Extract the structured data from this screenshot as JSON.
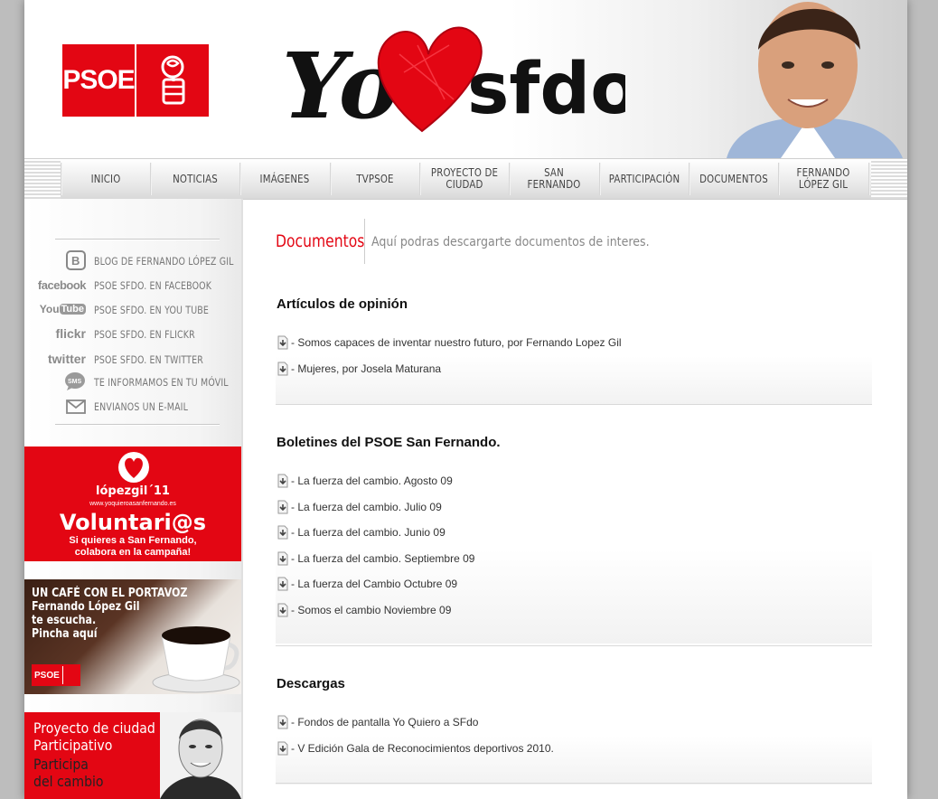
{
  "header": {
    "psoe_logo_text": "PSOE",
    "brand_text": "Yo ♥ sfdo",
    "brand_left": "Yo",
    "brand_right": "sfdo"
  },
  "nav": {
    "items": [
      {
        "label": "INICIO"
      },
      {
        "label": "NOTICIAS"
      },
      {
        "label": "IMÁGENES"
      },
      {
        "label": "TVPSOE"
      },
      {
        "label": "PROYECTO DE CIUDAD"
      },
      {
        "label": "SAN FERNANDO"
      },
      {
        "label": "PARTICIPACIÓN"
      },
      {
        "label": "DOCUMENTOS"
      },
      {
        "label": "FERNANDO LÓPEZ GIL"
      }
    ]
  },
  "sidebar": {
    "social": [
      {
        "icon": "blogger-icon",
        "icon_text": "B",
        "label": "BLOG DE FERNANDO LÓPEZ GIL"
      },
      {
        "icon": "facebook-icon",
        "icon_text": "facebook",
        "label": "PSOE SFDO.  EN FACEBOOK"
      },
      {
        "icon": "youtube-icon",
        "icon_text": "YouTube",
        "label": "PSOE SFDO.  EN YOU TUBE"
      },
      {
        "icon": "flickr-icon",
        "icon_text": "flickr",
        "label": "PSOE SFDO.  EN FLICKR"
      },
      {
        "icon": "twitter-icon",
        "icon_text": "twitter",
        "label": "PSOE SFDO.  EN TWITTER"
      },
      {
        "icon": "sms-icon",
        "icon_text": "SMS",
        "label": "TE INFORMAMOS EN TU MÓVIL"
      },
      {
        "icon": "email-icon",
        "icon_text": "",
        "label": "ENVIANOS UN E-MAIL"
      }
    ],
    "banner_voluntarios": {
      "tag": "lópezgil´11",
      "url": "www.yoquieroasanfernando.es",
      "title": "Voluntari@s",
      "line1": "Si quieres a San Fernando,",
      "line2": "colabora en la campaña!"
    },
    "banner_cafe": {
      "line1": "UN CAFÉ CON EL PORTAVOZ",
      "line2": "Fernando López Gil",
      "line3": "te escucha.",
      "line4": "Pincha aquí",
      "logo": "PSOE"
    },
    "banner_proyecto": {
      "line1": "Proyecto de ciudad",
      "line2": "Participativo",
      "line3": "Participa",
      "line4": "del cambio"
    }
  },
  "main": {
    "title": "Documentos",
    "subtitle": "Aquí podras descargarte documentos de interes.",
    "sections": [
      {
        "title": "Artículos de opinión",
        "links": [
          "- Somos capaces de inventar nuestro futuro, por Fernando Lopez Gil",
          "- Mujeres, por Josela Maturana"
        ]
      },
      {
        "title": "Boletines del PSOE San Fernando.",
        "links": [
          "- La fuerza del cambio. Agosto 09",
          "- La fuerza del cambio. Julio 09",
          "- La fuerza del cambio. Junio 09",
          "- La fuerza del cambio. Septiembre 09",
          "- La fuerza del Cambio Octubre 09",
          "- Somos el cambio Noviembre 09"
        ]
      },
      {
        "title": "Descargas",
        "links": [
          "- Fondos de pantalla Yo Quiero a SFdo",
          "- V Edición Gala de Reconocimientos deportivos 2010."
        ]
      }
    ]
  },
  "colors": {
    "brand_red": "#e30613",
    "title_red": "#e30613",
    "text_dark": "#111111",
    "nav_text": "#444444"
  }
}
